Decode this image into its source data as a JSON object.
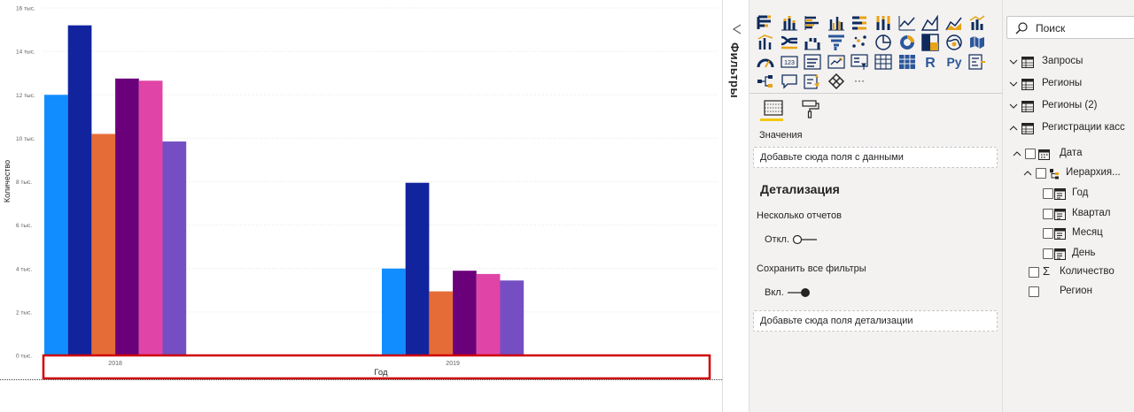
{
  "chart": {
    "ylabel": "Количество",
    "xlabel": "Год",
    "y_tick_labels": [
      "0 тыс.",
      "2 тыс.",
      "4 тыс.",
      "6 тыс.",
      "8 тыс.",
      "10 тыс.",
      "12 тыс.",
      "14 тыс.",
      "16 тыс."
    ],
    "highlight_color": "#d00000"
  },
  "chart_data": {
    "type": "bar",
    "categories": [
      "2018",
      "2019"
    ],
    "xlabel": "Год",
    "ylabel": "Количество",
    "ylim": [
      0,
      16000
    ],
    "grid": true,
    "legend": "none",
    "series": [
      {
        "values": [
          12000,
          4000
        ],
        "color": "#118dff"
      },
      {
        "values": [
          15200,
          7950
        ],
        "color": "#12239e"
      },
      {
        "values": [
          10200,
          2950
        ],
        "color": "#e66c37"
      },
      {
        "values": [
          12750,
          3900
        ],
        "color": "#6b007b"
      },
      {
        "values": [
          12650,
          3750
        ],
        "color": "#e044a7"
      },
      {
        "values": [
          9850,
          3450
        ],
        "color": "#744ec2"
      }
    ]
  },
  "filters": {
    "label": "Фильтры"
  },
  "viz": {
    "icons": [
      "stacked-bar-chart-icon",
      "stacked-column-chart-icon",
      "clustered-bar-chart-icon",
      "clustered-column-chart-icon",
      "100-stacked-bar-chart-icon",
      "100-stacked-column-chart-icon",
      "line-chart-icon",
      "area-chart-icon",
      "stacked-area-chart-icon",
      "line-and-stacked-column-chart-icon",
      "line-and-clustered-column-chart-icon",
      "ribbon-chart-icon",
      "waterfall-chart-icon",
      "funnel-chart-icon",
      "scatter-chart-icon",
      "pie-chart-icon",
      "donut-chart-icon",
      "treemap-icon",
      "map-icon",
      "filled-map-icon",
      "gauge-icon",
      "card-icon",
      "multi-row-card-icon",
      "kpi-icon",
      "slicer-icon",
      "table-icon",
      "matrix-icon",
      "r-script-visual-icon",
      "python-visual-icon",
      "key-influencers-icon",
      "decomposition-tree-icon",
      "qa-icon",
      "smart-narrative-icon",
      "power-apps-icon",
      "more-visuals-icon"
    ],
    "r_label": "R",
    "py_label": "Py",
    "more_label": "···",
    "fields_tab_icon": "fields-tab-icon",
    "format_tab_icon": "paint-roller-icon",
    "accent": "#f2c811",
    "values_label": "Значения",
    "values_placeholder": "Добавьте сюда поля с данными",
    "drillthrough_header": "Детализация",
    "cross_report_label": "Несколько отчетов",
    "cross_report_toggle": "Откл.",
    "cross_report_on": false,
    "keep_filters_label": "Сохранить все фильтры",
    "keep_filters_toggle": "Вкл.",
    "keep_filters_on": true,
    "drill_placeholder": "Добавьте сюда поля детализации"
  },
  "fields": {
    "search_placeholder": "Поиск",
    "tables": [
      {
        "name": "Запросы",
        "expanded": false
      },
      {
        "name": "Регионы",
        "expanded": false
      },
      {
        "name": "Регионы (2)",
        "expanded": false
      },
      {
        "name": "Регистрации касс",
        "expanded": true
      }
    ],
    "date_field": "Дата",
    "hierarchy_field": "Иерархия...",
    "hierarchy_levels": [
      "Год",
      "Квартал",
      "Месяц",
      "День"
    ],
    "measure_field": "Количество",
    "region_field": "Регион",
    "sigma": "Σ"
  }
}
